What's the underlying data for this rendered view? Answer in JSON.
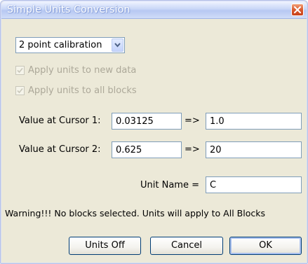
{
  "window": {
    "title": "Simple Units Conversion"
  },
  "mode_select": {
    "value": "2 point calibration"
  },
  "options": {
    "apply_new_data": "Apply units to new data",
    "apply_all_blocks": "Apply units to all blocks",
    "apply_new_data_checked": true,
    "apply_all_blocks_checked": true
  },
  "cursor1": {
    "label": "Value at Cursor 1:",
    "value": "0.03125",
    "arrow": "=>",
    "converted": "1.0"
  },
  "cursor2": {
    "label": "Value at Cursor 2:",
    "value": "0.625",
    "arrow": "=>",
    "converted": "20"
  },
  "unit": {
    "label": "Unit Name =",
    "value": "C"
  },
  "warning": "Warning!!! No blocks selected. Units will apply to All Blocks",
  "buttons": {
    "units_off": "Units Off",
    "cancel": "Cancel",
    "ok": "OK"
  },
  "icons": {
    "close": "close-icon",
    "dropdown": "chevron-down-icon",
    "check": "check-icon"
  },
  "colors": {
    "dialog_bg": "#ece9d8",
    "title_gradient_top": "#f0f4ff",
    "title_gradient_bottom": "#b7c8f2",
    "close_red": "#d85a2f",
    "disabled_text": "#aca899",
    "input_border": "#7f9db9"
  }
}
